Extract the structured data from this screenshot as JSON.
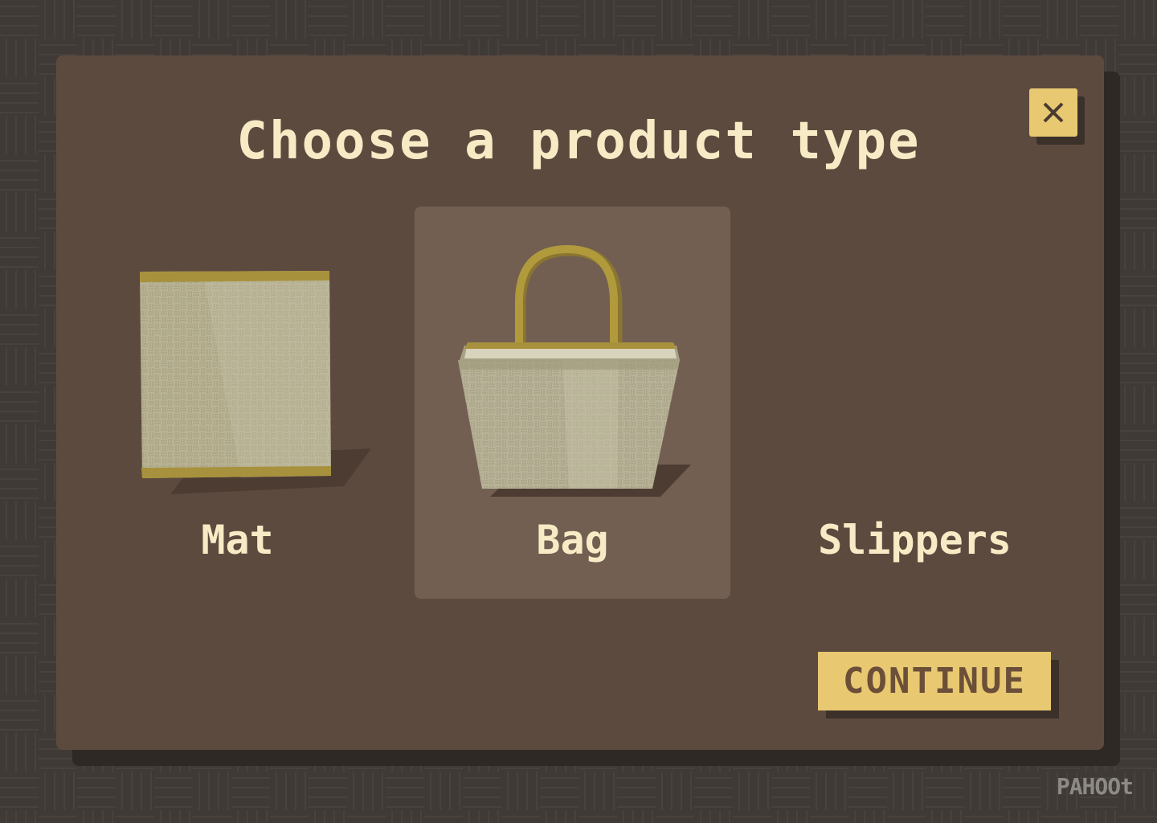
{
  "modal": {
    "title": "Choose a product type",
    "close_icon": "close-icon"
  },
  "options": [
    {
      "label": "Mat",
      "icon": "mat-illustration",
      "selected": false
    },
    {
      "label": "Bag",
      "icon": "bag-illustration",
      "selected": true
    },
    {
      "label": "Slippers",
      "icon": "none",
      "selected": false
    }
  ],
  "continue_label": "CONTINUE",
  "brand": "PAHOOt",
  "colors": {
    "background": "#3f3a35",
    "modal": "#5d4a3f",
    "selected_card": "#725f52",
    "accent": "#e8c871",
    "text": "#f7ebc5"
  }
}
